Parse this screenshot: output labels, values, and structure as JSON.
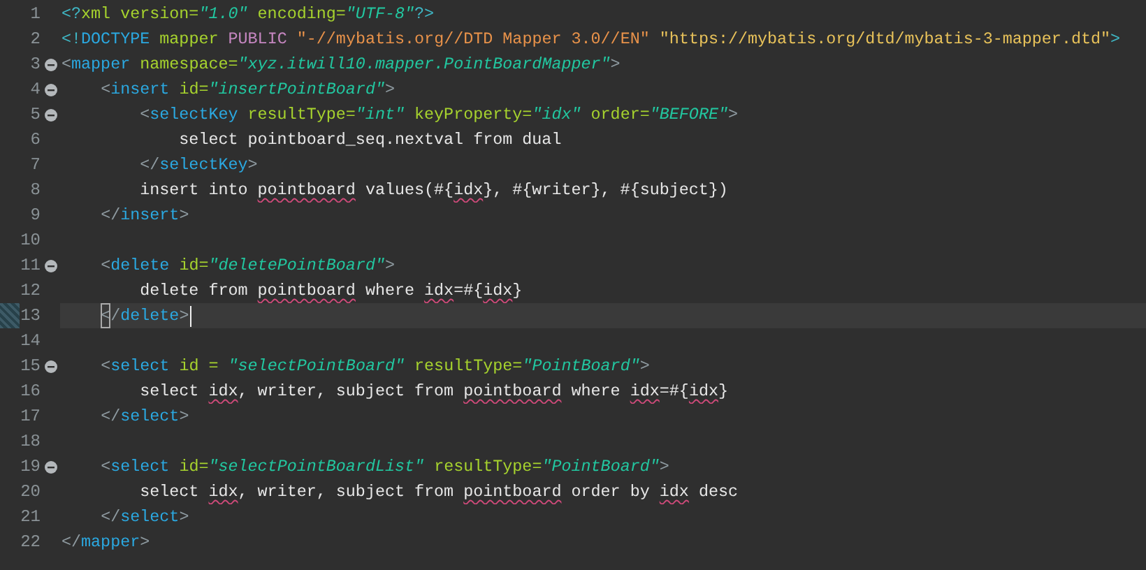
{
  "editor": {
    "lines": [
      {
        "number": "1",
        "fold": false,
        "current": false,
        "tokens": [
          {
            "kind": "punct",
            "text": "<?"
          },
          {
            "kind": "attr",
            "text": "xml version="
          },
          {
            "kind": "value",
            "text": "\"1.0\""
          },
          {
            "kind": "attr",
            "text": " encoding="
          },
          {
            "kind": "value",
            "text": "\"UTF-8\""
          },
          {
            "kind": "punct",
            "text": "?>"
          }
        ]
      },
      {
        "number": "2",
        "fold": false,
        "current": false,
        "tokens": [
          {
            "kind": "punct",
            "text": "<!"
          },
          {
            "kind": "tag",
            "text": "DOCTYPE"
          },
          {
            "kind": "attr",
            "text": " mapper "
          },
          {
            "kind": "keyword",
            "text": "PUBLIC"
          },
          {
            "kind": "public-id",
            "text": " \"-//mybatis.org//DTD Mapper 3.0//EN\""
          },
          {
            "kind": "system-id",
            "text": " \"https://mybatis.org/dtd/mybatis-3-mapper.dtd\""
          },
          {
            "kind": "punct",
            "text": ">"
          }
        ]
      },
      {
        "number": "3",
        "fold": true,
        "current": false,
        "tokens": [
          {
            "kind": "bracket",
            "text": "<"
          },
          {
            "kind": "tag",
            "text": "mapper"
          },
          {
            "kind": "attr",
            "text": " namespace="
          },
          {
            "kind": "value",
            "text": "\"xyz.itwill10.mapper.PointBoardMapper\""
          },
          {
            "kind": "bracket",
            "text": ">"
          }
        ]
      },
      {
        "number": "4",
        "fold": true,
        "current": false,
        "tokens": [
          {
            "kind": "bracket",
            "text": "    <"
          },
          {
            "kind": "tag",
            "text": "insert"
          },
          {
            "kind": "attr",
            "text": " id="
          },
          {
            "kind": "value",
            "text": "\"insertPointBoard\""
          },
          {
            "kind": "bracket",
            "text": ">"
          }
        ]
      },
      {
        "number": "5",
        "fold": true,
        "current": false,
        "tokens": [
          {
            "kind": "bracket",
            "text": "        <"
          },
          {
            "kind": "tag",
            "text": "selectKey"
          },
          {
            "kind": "attr",
            "text": " resultType="
          },
          {
            "kind": "value",
            "text": "\"int\""
          },
          {
            "kind": "attr",
            "text": " keyProperty="
          },
          {
            "kind": "value",
            "text": "\"idx\""
          },
          {
            "kind": "attr",
            "text": " order="
          },
          {
            "kind": "value",
            "text": "\"BEFORE\""
          },
          {
            "kind": "bracket",
            "text": ">"
          }
        ]
      },
      {
        "number": "6",
        "fold": false,
        "current": false,
        "tokens": [
          {
            "kind": "plain",
            "text": "            select pointboard_seq.nextval from dual"
          }
        ]
      },
      {
        "number": "7",
        "fold": false,
        "current": false,
        "tokens": [
          {
            "kind": "bracket",
            "text": "        </"
          },
          {
            "kind": "tag",
            "text": "selectKey"
          },
          {
            "kind": "bracket",
            "text": ">"
          }
        ]
      },
      {
        "number": "8",
        "fold": false,
        "current": false,
        "tokens": [
          {
            "kind": "plain",
            "text": "        insert into "
          },
          {
            "kind": "flagged",
            "text": "pointboard"
          },
          {
            "kind": "plain",
            "text": " values(#{"
          },
          {
            "kind": "flagged",
            "text": "idx"
          },
          {
            "kind": "plain",
            "text": "}, #{writer}, #{subject})"
          }
        ]
      },
      {
        "number": "9",
        "fold": false,
        "current": false,
        "tokens": [
          {
            "kind": "bracket",
            "text": "    </"
          },
          {
            "kind": "tag",
            "text": "insert"
          },
          {
            "kind": "bracket",
            "text": ">"
          }
        ]
      },
      {
        "number": "10",
        "fold": false,
        "current": false
      },
      {
        "number": "11",
        "fold": true,
        "current": false,
        "tokens": [
          {
            "kind": "bracket",
            "text": "    <"
          },
          {
            "kind": "tag",
            "text": "delete"
          },
          {
            "kind": "attr",
            "text": " id="
          },
          {
            "kind": "value",
            "text": "\"deletePointBoard\""
          },
          {
            "kind": "bracket",
            "text": ">"
          }
        ]
      },
      {
        "number": "12",
        "fold": false,
        "current": false,
        "tokens": [
          {
            "kind": "plain",
            "text": "        delete from "
          },
          {
            "kind": "flagged",
            "text": "pointboard"
          },
          {
            "kind": "plain",
            "text": " where "
          },
          {
            "kind": "flagged",
            "text": "idx"
          },
          {
            "kind": "plain",
            "text": "=#{"
          },
          {
            "kind": "flagged",
            "text": "idx"
          },
          {
            "kind": "plain",
            "text": "}"
          }
        ]
      },
      {
        "number": "13",
        "fold": false,
        "current": true,
        "tokens": [
          {
            "kind": "matched-bracket",
            "text": "    <"
          },
          {
            "kind": "bracket",
            "text": "/"
          },
          {
            "kind": "tag",
            "text": "delete"
          },
          {
            "kind": "bracket",
            "text": ">"
          }
        ]
      },
      {
        "number": "14",
        "fold": false,
        "current": false
      },
      {
        "number": "15",
        "fold": true,
        "current": false,
        "tokens": [
          {
            "kind": "bracket",
            "text": "    <"
          },
          {
            "kind": "tag",
            "text": "select"
          },
          {
            "kind": "attr",
            "text": " id = "
          },
          {
            "kind": "value",
            "text": "\"selectPointBoard\""
          },
          {
            "kind": "attr",
            "text": " resultType="
          },
          {
            "kind": "value",
            "text": "\"PointBoard\""
          },
          {
            "kind": "bracket",
            "text": ">"
          }
        ]
      },
      {
        "number": "16",
        "fold": false,
        "current": false,
        "tokens": [
          {
            "kind": "plain",
            "text": "        select "
          },
          {
            "kind": "flagged",
            "text": "idx"
          },
          {
            "kind": "plain",
            "text": ", writer, subject from "
          },
          {
            "kind": "flagged",
            "text": "pointboard"
          },
          {
            "kind": "plain",
            "text": " where "
          },
          {
            "kind": "flagged",
            "text": "idx"
          },
          {
            "kind": "plain",
            "text": "=#{"
          },
          {
            "kind": "flagged",
            "text": "idx"
          },
          {
            "kind": "plain",
            "text": "}"
          }
        ]
      },
      {
        "number": "17",
        "fold": false,
        "current": false,
        "tokens": [
          {
            "kind": "bracket",
            "text": "    </"
          },
          {
            "kind": "tag",
            "text": "select"
          },
          {
            "kind": "bracket",
            "text": ">"
          }
        ]
      },
      {
        "number": "18",
        "fold": false,
        "current": false
      },
      {
        "number": "19",
        "fold": true,
        "current": false,
        "tokens": [
          {
            "kind": "bracket",
            "text": "    <"
          },
          {
            "kind": "tag",
            "text": "select"
          },
          {
            "kind": "attr",
            "text": " id="
          },
          {
            "kind": "value",
            "text": "\"selectPointBoardList\""
          },
          {
            "kind": "attr",
            "text": " resultType="
          },
          {
            "kind": "value",
            "text": "\"PointBoard\""
          },
          {
            "kind": "bracket",
            "text": ">"
          }
        ]
      },
      {
        "number": "20",
        "fold": false,
        "current": false,
        "tokens": [
          {
            "kind": "plain",
            "text": "        select "
          },
          {
            "kind": "flagged",
            "text": "idx"
          },
          {
            "kind": "plain",
            "text": ", writer, subject from "
          },
          {
            "kind": "flagged",
            "text": "pointboard"
          },
          {
            "kind": "plain",
            "text": " order by "
          },
          {
            "kind": "flagged",
            "text": "idx"
          },
          {
            "kind": "plain",
            "text": " desc"
          }
        ]
      },
      {
        "number": "21",
        "fold": false,
        "current": false,
        "tokens": [
          {
            "kind": "bracket",
            "text": "    </"
          },
          {
            "kind": "tag",
            "text": "select"
          },
          {
            "kind": "bracket",
            "text": ">"
          }
        ]
      },
      {
        "number": "22",
        "fold": false,
        "current": false,
        "tokens": [
          {
            "kind": "bracket",
            "text": "</"
          },
          {
            "kind": "tag",
            "text": "mapper"
          },
          {
            "kind": "bracket",
            "text": ">"
          }
        ]
      }
    ]
  }
}
